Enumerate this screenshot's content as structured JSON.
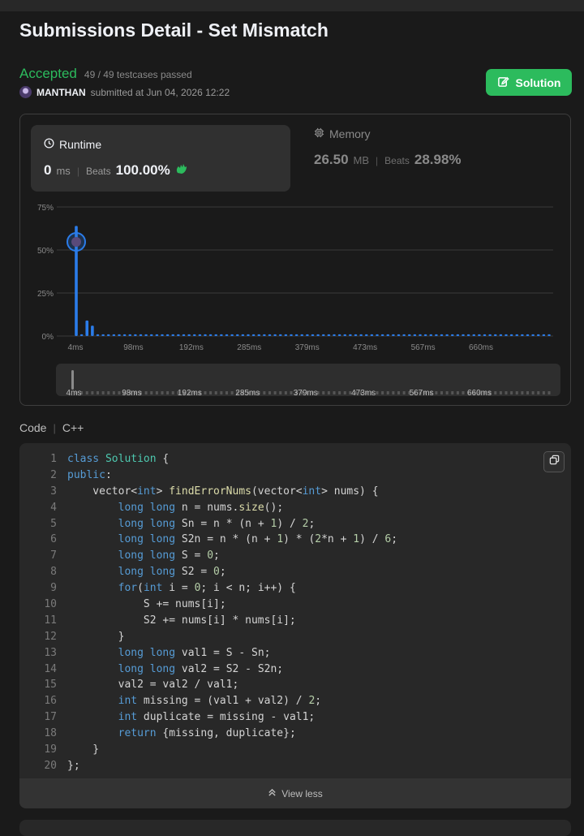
{
  "page": {
    "title": "Submissions Detail - Set Mismatch"
  },
  "submission": {
    "status": "Accepted",
    "testcases": "49 / 49 testcases passed",
    "username": "MANTHAN",
    "submitted_text": "submitted at Jun 04, 2026 12:22"
  },
  "solution_button": {
    "label": "Solution",
    "icon": "edit-icon"
  },
  "runtime": {
    "label": "Runtime",
    "value": "0",
    "unit": "ms",
    "beats_label": "Beats",
    "beats_value": "100.00%",
    "icon": "clock-icon",
    "badge": "clapping-hands-icon"
  },
  "memory": {
    "label": "Memory",
    "value": "26.50",
    "unit": "MB",
    "beats_label": "Beats",
    "beats_value": "28.98%",
    "icon": "chip-icon"
  },
  "chart_data": {
    "type": "bar",
    "y_ticks": [
      "75%",
      "50%",
      "25%",
      "0%"
    ],
    "ylim": [
      0,
      75
    ],
    "x_ticks": [
      "4ms",
      "98ms",
      "192ms",
      "285ms",
      "379ms",
      "473ms",
      "567ms",
      "660ms"
    ],
    "series": [
      {
        "values": [
          64,
          1,
          9,
          6,
          1,
          1,
          1,
          1,
          1,
          1,
          1,
          1,
          1,
          1,
          1,
          1,
          1,
          1,
          1,
          1,
          1,
          1,
          1,
          1,
          1,
          1,
          1,
          1,
          1,
          1,
          1,
          1,
          1,
          1,
          1,
          1,
          1,
          1,
          1,
          1,
          1,
          1,
          1,
          1,
          1,
          1,
          1,
          1,
          1,
          1,
          1,
          1,
          1,
          1,
          1,
          1,
          1,
          1,
          1,
          1,
          1,
          1,
          1,
          1,
          1,
          1,
          1,
          1,
          1,
          1,
          1,
          1,
          1,
          1,
          1,
          1,
          1,
          1,
          1,
          1,
          1,
          1,
          1,
          1,
          1,
          1,
          1,
          1,
          1
        ]
      }
    ],
    "highlight_index": 0,
    "grid": true,
    "colors": {
      "bar": "#2b7ce9",
      "grid": "#3a3a3a"
    }
  },
  "code": {
    "label": "Code",
    "language": "C++",
    "lines": [
      "class Solution {",
      "public:",
      "    vector<int> findErrorNums(vector<int> nums) {",
      "        long long n = nums.size();",
      "        long long Sn = n * (n + 1) / 2;",
      "        long long S2n = n * (n + 1) * (2*n + 1) / 6;",
      "        long long S = 0;",
      "        long long S2 = 0;",
      "        for(int i = 0; i < n; i++) {",
      "            S += nums[i];",
      "            S2 += nums[i] * nums[i];",
      "        }",
      "        long long val1 = S - Sn;",
      "        long long val2 = S2 - S2n;",
      "        val2 = val2 / val1;",
      "        int missing = (val1 + val2) / 2;",
      "        int duplicate = missing - val1;",
      "        return {missing, duplicate};",
      "    }",
      "};"
    ],
    "view_less_label": "View less",
    "copy_icon": "copy-icon"
  }
}
